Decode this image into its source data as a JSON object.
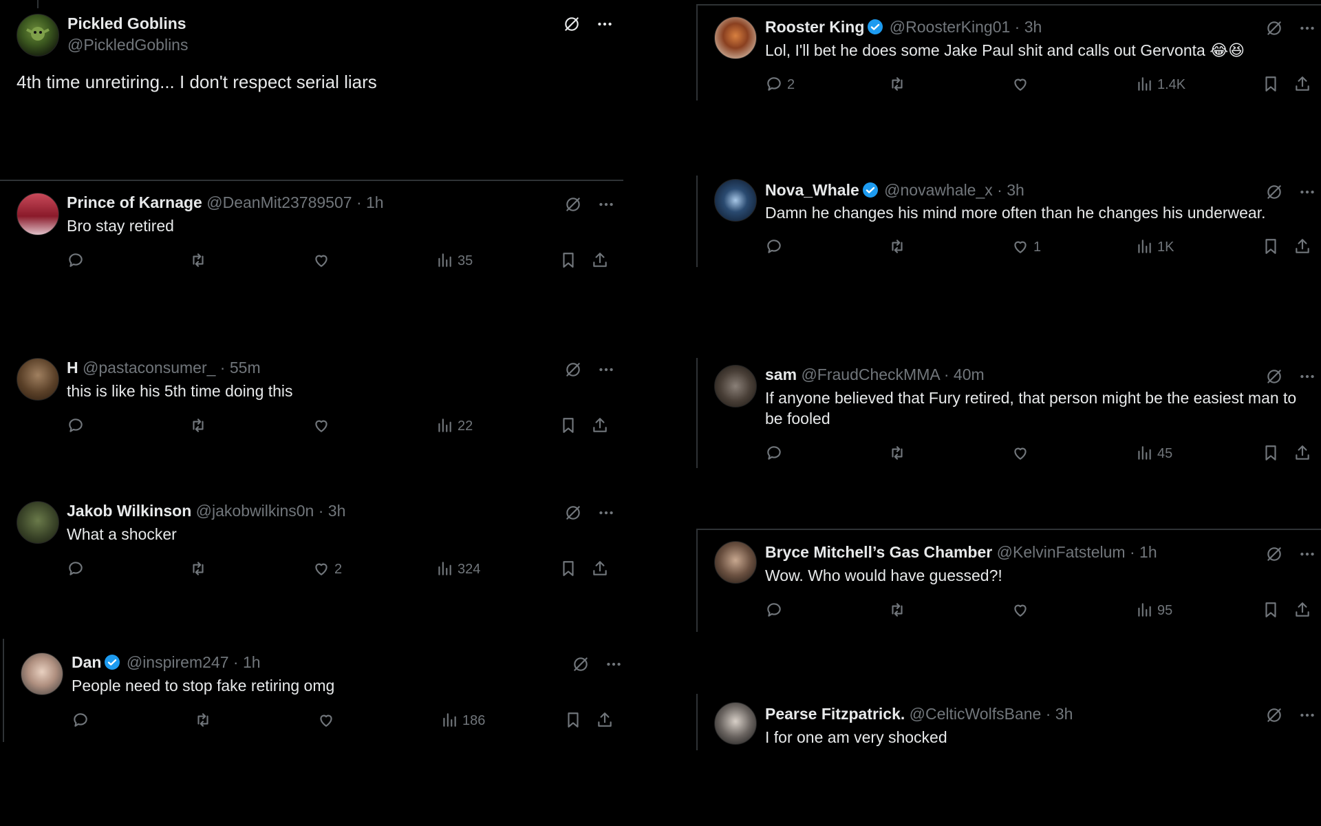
{
  "colors": {
    "background": "#000000",
    "text": "#e7e9ea",
    "muted": "#71767b",
    "verified": "#1d9bf0",
    "divider": "#2f3336"
  },
  "left_column": [
    {
      "name": "Pickled Goblins",
      "handle": "@PickledGoblins",
      "time": "",
      "text": "4th time unretiring... I don't respect serial liars"
    },
    {
      "name": "Prince of Karnage",
      "handle": "@DeanMit23789507",
      "time": "1h",
      "text": "Bro stay retired",
      "replies": "",
      "retweets": "",
      "likes": "",
      "views": "35"
    },
    {
      "name": "H",
      "handle": "@pastaconsumer_",
      "time": "55m",
      "text": "this is like his 5th time doing this",
      "replies": "",
      "retweets": "",
      "likes": "",
      "views": "22"
    },
    {
      "name": "Jakob Wilkinson",
      "handle": "@jakobwilkins0n",
      "time": "3h",
      "text": "What a shocker",
      "replies": "",
      "retweets": "",
      "likes": "2",
      "views": "324"
    },
    {
      "name": "Dan",
      "handle": "@inspirem247",
      "time": "1h",
      "text": "People need to stop fake retiring omg",
      "replies": "",
      "retweets": "",
      "likes": "",
      "views": "186"
    }
  ],
  "right_column": [
    {
      "name": "Rooster King",
      "handle": "@RoosterKing01",
      "time": "3h",
      "text": "Lol, I'll bet he does some Jake Paul shit and calls out Gervonta 😂😆",
      "replies": "2",
      "retweets": "",
      "likes": "",
      "views": "1.4K"
    },
    {
      "name": "Nova_Whale",
      "handle": "@novawhale_x",
      "time": "3h",
      "text": "Damn he changes his mind more often than he changes his underwear.",
      "replies": "",
      "retweets": "",
      "likes": "1",
      "views": "1K"
    },
    {
      "name": "sam",
      "handle": "@FraudCheckMMA",
      "time": "40m",
      "text": "If anyone believed that Fury retired, that person might be the easiest man to be fooled",
      "replies": "",
      "retweets": "",
      "likes": "",
      "views": "45"
    },
    {
      "name": "Bryce Mitchell’s Gas Chamber",
      "handle": "@KelvinFatstelum",
      "time": "1h",
      "text": "Wow. Who would have guessed?!",
      "replies": "",
      "retweets": "",
      "likes": "",
      "views": "95"
    },
    {
      "name": "Pearse Fitzpatrick.",
      "handle": "@CelticWolfsBane",
      "time": "3h",
      "text": "I for one am very shocked"
    }
  ],
  "icons": {
    "reply": "reply-icon",
    "retweet": "retweet-icon",
    "like": "heart-icon",
    "views": "views-icon",
    "bookmark": "bookmark-icon",
    "share": "share-icon",
    "grok": "grok-icon",
    "more": "more-icon",
    "verified": "verified-badge-icon"
  }
}
